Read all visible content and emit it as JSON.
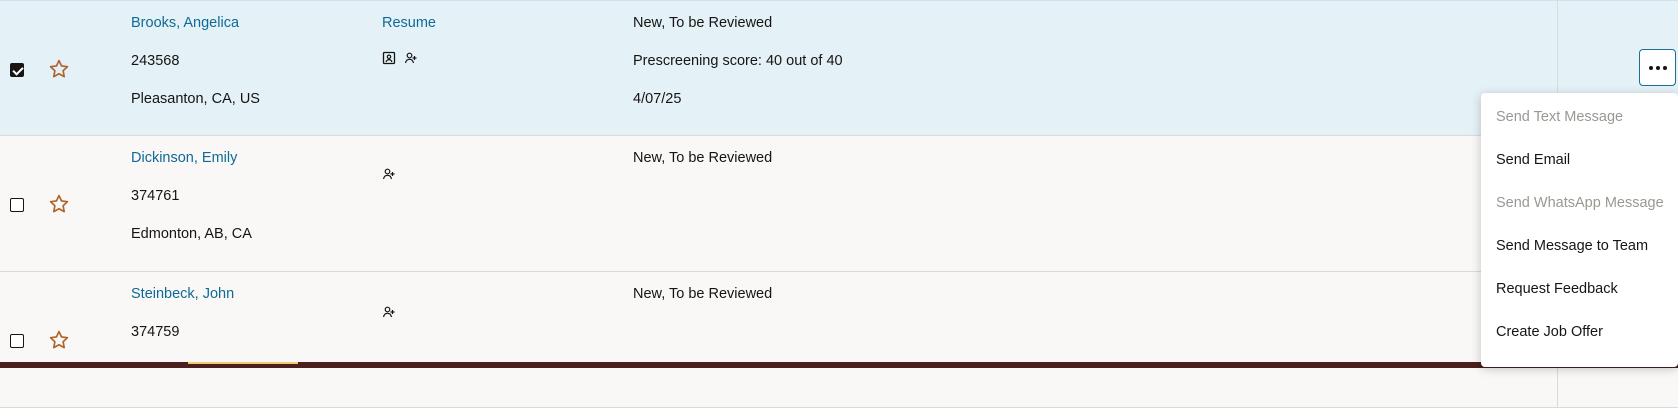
{
  "candidates": [
    {
      "name": "Brooks, Angelica",
      "id": "243568",
      "location": "Pleasanton, CA, US",
      "resume": "Resume",
      "status": "New, To be Reviewed",
      "prescreening": "Prescreening score: 40 out of 40",
      "date": "4/07/25",
      "selected": true
    },
    {
      "name": "Dickinson, Emily",
      "id": "374761",
      "location": "Edmonton, AB, CA",
      "status": "New, To be Reviewed",
      "selected": false
    },
    {
      "name": "Steinbeck, John",
      "id": "374759",
      "status": "New, To be Reviewed",
      "selected": false
    }
  ],
  "actions_menu": {
    "button_icon": "more-horizontal-icon",
    "items": [
      {
        "label": "Send Text Message",
        "disabled": true
      },
      {
        "label": "Send Email",
        "disabled": false
      },
      {
        "label": "Send WhatsApp Message",
        "disabled": true
      },
      {
        "label": "Send Message to Team",
        "disabled": false
      },
      {
        "label": "Request Feedback",
        "disabled": false
      },
      {
        "label": "Create Job Offer",
        "disabled": false
      }
    ]
  },
  "colors": {
    "link": "#0f6a96",
    "selected_row": "#e4f1f7",
    "star": "#b0622a",
    "bottom_bar": "#4a1f1e"
  }
}
